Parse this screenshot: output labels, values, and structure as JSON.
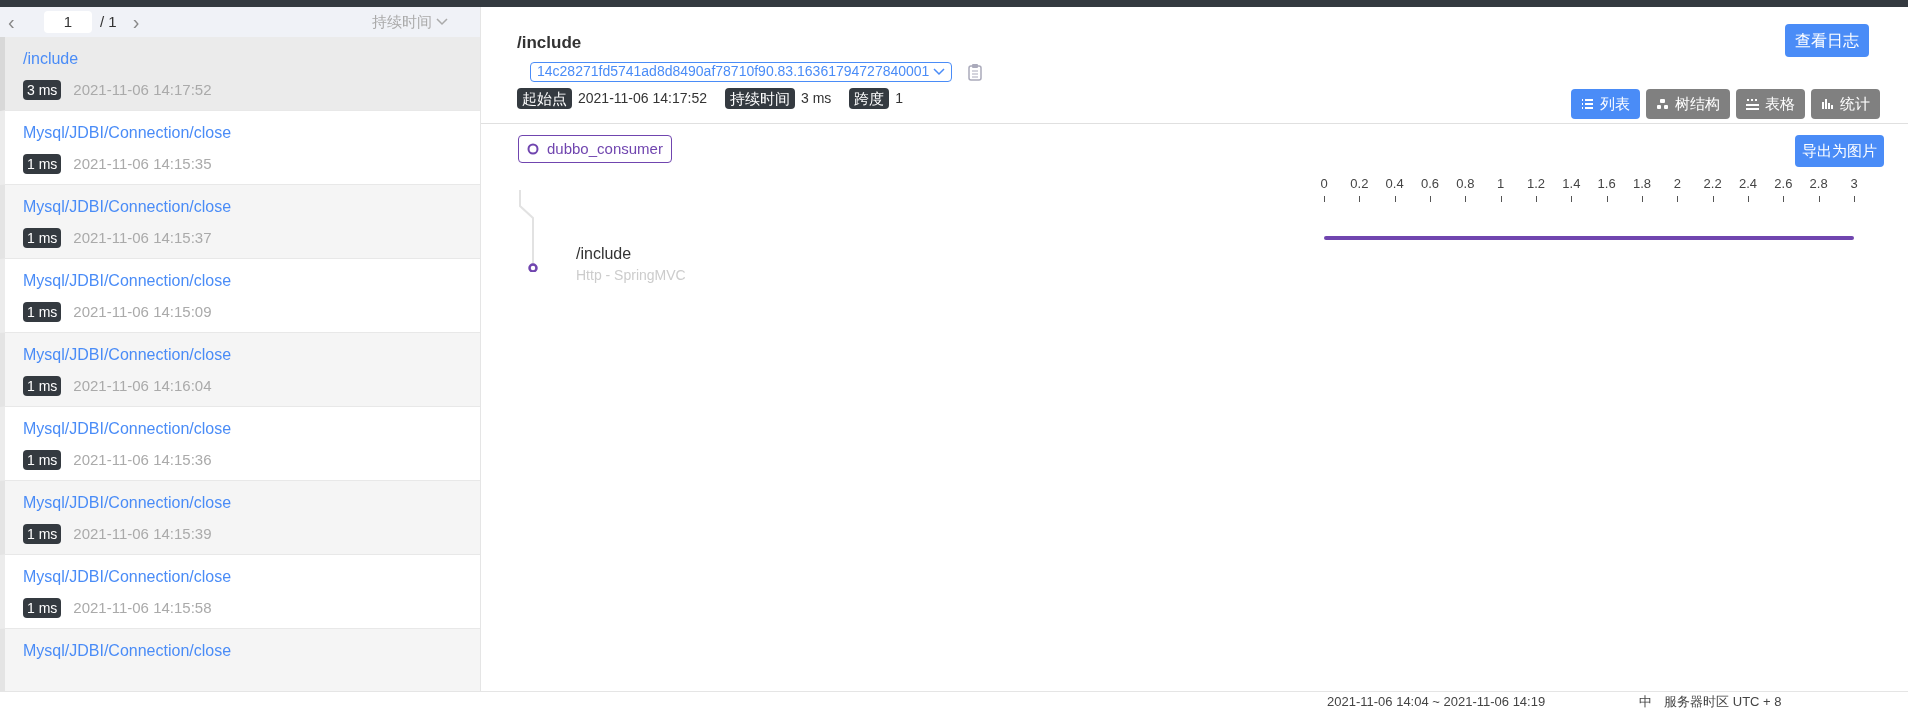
{
  "pager": {
    "prev": "‹",
    "page": "1",
    "total": "/ 1",
    "next": "›",
    "sort": "持续时间"
  },
  "traces": [
    {
      "name": "/include",
      "duration": "3 ms",
      "time": "2021-11-06 14:17:52",
      "selected": true
    },
    {
      "name": "Mysql/JDBI/Connection/close",
      "duration": "1 ms",
      "time": "2021-11-06 14:15:35",
      "selected": false
    },
    {
      "name": "Mysql/JDBI/Connection/close",
      "duration": "1 ms",
      "time": "2021-11-06 14:15:37",
      "selected": false
    },
    {
      "name": "Mysql/JDBI/Connection/close",
      "duration": "1 ms",
      "time": "2021-11-06 14:15:09",
      "selected": false
    },
    {
      "name": "Mysql/JDBI/Connection/close",
      "duration": "1 ms",
      "time": "2021-11-06 14:16:04",
      "selected": false
    },
    {
      "name": "Mysql/JDBI/Connection/close",
      "duration": "1 ms",
      "time": "2021-11-06 14:15:36",
      "selected": false
    },
    {
      "name": "Mysql/JDBI/Connection/close",
      "duration": "1 ms",
      "time": "2021-11-06 14:15:39",
      "selected": false
    },
    {
      "name": "Mysql/JDBI/Connection/close",
      "duration": "1 ms",
      "time": "2021-11-06 14:15:58",
      "selected": false
    },
    {
      "name": "Mysql/JDBI/Connection/close",
      "selected": false
    }
  ],
  "detail": {
    "title": "/include",
    "trace_id": "14c28271fd5741ad8d8490af78710f90.83.16361794727840001",
    "meta": [
      {
        "label": "起始点",
        "value": "2021-11-06 14:17:52"
      },
      {
        "label": "持续时间",
        "value": "3 ms"
      },
      {
        "label": "跨度",
        "value": "1"
      }
    ],
    "log_button": "查看日志",
    "views": [
      {
        "label": "列表",
        "selected": true
      },
      {
        "label": "树结构",
        "selected": false
      },
      {
        "label": "表格",
        "selected": false
      },
      {
        "label": "统计",
        "selected": false
      }
    ],
    "service": "dubbo_consumer",
    "export_button": "导出为图片",
    "spans": [
      {
        "name": "/include",
        "component": "Http - SpringMVC",
        "level": 1
      }
    ],
    "timeline_ticks": [
      "0",
      "0.2",
      "0.4",
      "0.6",
      "0.8",
      "1",
      "1.2",
      "1.4",
      "1.6",
      "1.8",
      "2",
      "2.2",
      "2.4",
      "2.6",
      "2.8",
      "3"
    ]
  },
  "status_bar": {
    "range": "2021-11-06 14:04 ~ 2021-11-06 14:19",
    "language": "中",
    "timezone": "服务器时区 UTC + 8"
  }
}
